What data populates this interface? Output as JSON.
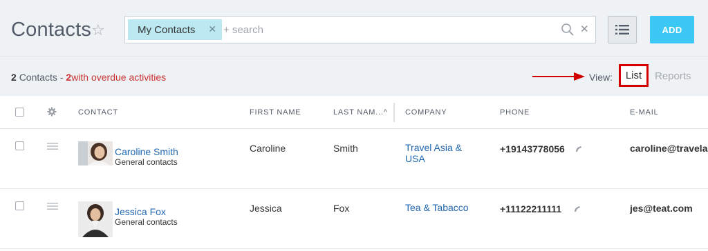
{
  "header": {
    "title": "Contacts",
    "search": {
      "filter_chip": "My Contacts",
      "placeholder": "+ search",
      "value": ""
    },
    "add_label": "ADD"
  },
  "summary": {
    "count": "2",
    "entity_label": "Contacts -",
    "overdue_count": "2",
    "overdue_label": "with overdue activities"
  },
  "view_switcher": {
    "label": "View:",
    "options": [
      "List",
      "Reports"
    ],
    "selected": "List"
  },
  "table": {
    "columns": [
      "CONTACT",
      "FIRST NAME",
      "LAST NAM...^",
      "COMPANY",
      "PHONE",
      "E-MAIL"
    ],
    "rows": [
      {
        "name": "Caroline Smith",
        "type": "General contacts",
        "first_name": "Caroline",
        "last_name": "Smith",
        "company": "Travel Asia & USA",
        "phone": "+19143778056",
        "email": "caroline@travelas"
      },
      {
        "name": "Jessica Fox",
        "type": "General contacts",
        "first_name": "Jessica",
        "last_name": "Fox",
        "company": "Tea & Tabacco",
        "phone": "+11122211111",
        "email": "jes@teat.com"
      }
    ]
  },
  "colors": {
    "accent": "#3bc8f5",
    "link": "#2067b0",
    "overdue": "#cc3333",
    "highlight_box": "#d40000",
    "arrow": "#d40000",
    "chip": "#bce8f1"
  }
}
